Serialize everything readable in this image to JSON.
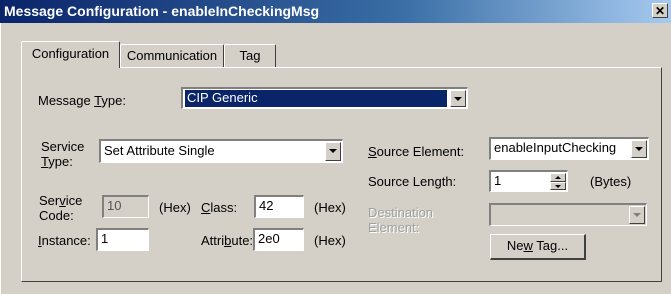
{
  "window": {
    "title": "Message Configuration - enableInCheckingMsg",
    "close_glyph": "✕"
  },
  "tabs": [
    {
      "label": "Configuration",
      "active": true
    },
    {
      "label": "Communication",
      "active": false
    },
    {
      "label": "Tag",
      "active": false
    }
  ],
  "message_type": {
    "label_pre": "Message ",
    "label_key": "T",
    "label_post": "ype:",
    "value": "CIP Generic"
  },
  "service_type": {
    "label_pre": "Service",
    "label_key": "T",
    "label_post": "ype:",
    "value": "Set Attribute Single"
  },
  "service_code": {
    "label_line1_pre": "Ser",
    "label_line1_key": "v",
    "label_line1_post": "ice",
    "label_line2": "Code:",
    "value": "10",
    "unit": "(Hex)"
  },
  "class": {
    "label_key": "C",
    "label_post": "lass:",
    "value": "42",
    "unit": "(Hex)"
  },
  "instance": {
    "label_key": "I",
    "label_post": "nstance:",
    "value": "1"
  },
  "attribute": {
    "label_pre": "Attri",
    "label_key": "b",
    "label_post": "ute:",
    "value": "2e0",
    "unit": "(Hex)"
  },
  "source_element": {
    "label_key": "S",
    "label_post": "ource Element:",
    "value": "enableInputChecking"
  },
  "source_length": {
    "label": "Source Length:",
    "value": "1",
    "unit": "(Bytes)"
  },
  "destination_element": {
    "label_line1": "Destination",
    "label_line2": "Element:",
    "value": ""
  },
  "new_tag_button": {
    "label_pre": "Ne",
    "label_key": "w",
    "label_post": " Tag..."
  },
  "colors": {
    "face": "#d4d0c8",
    "title_start": "#0a246a",
    "title_end": "#a6caf0",
    "selection": "#0a246a"
  }
}
